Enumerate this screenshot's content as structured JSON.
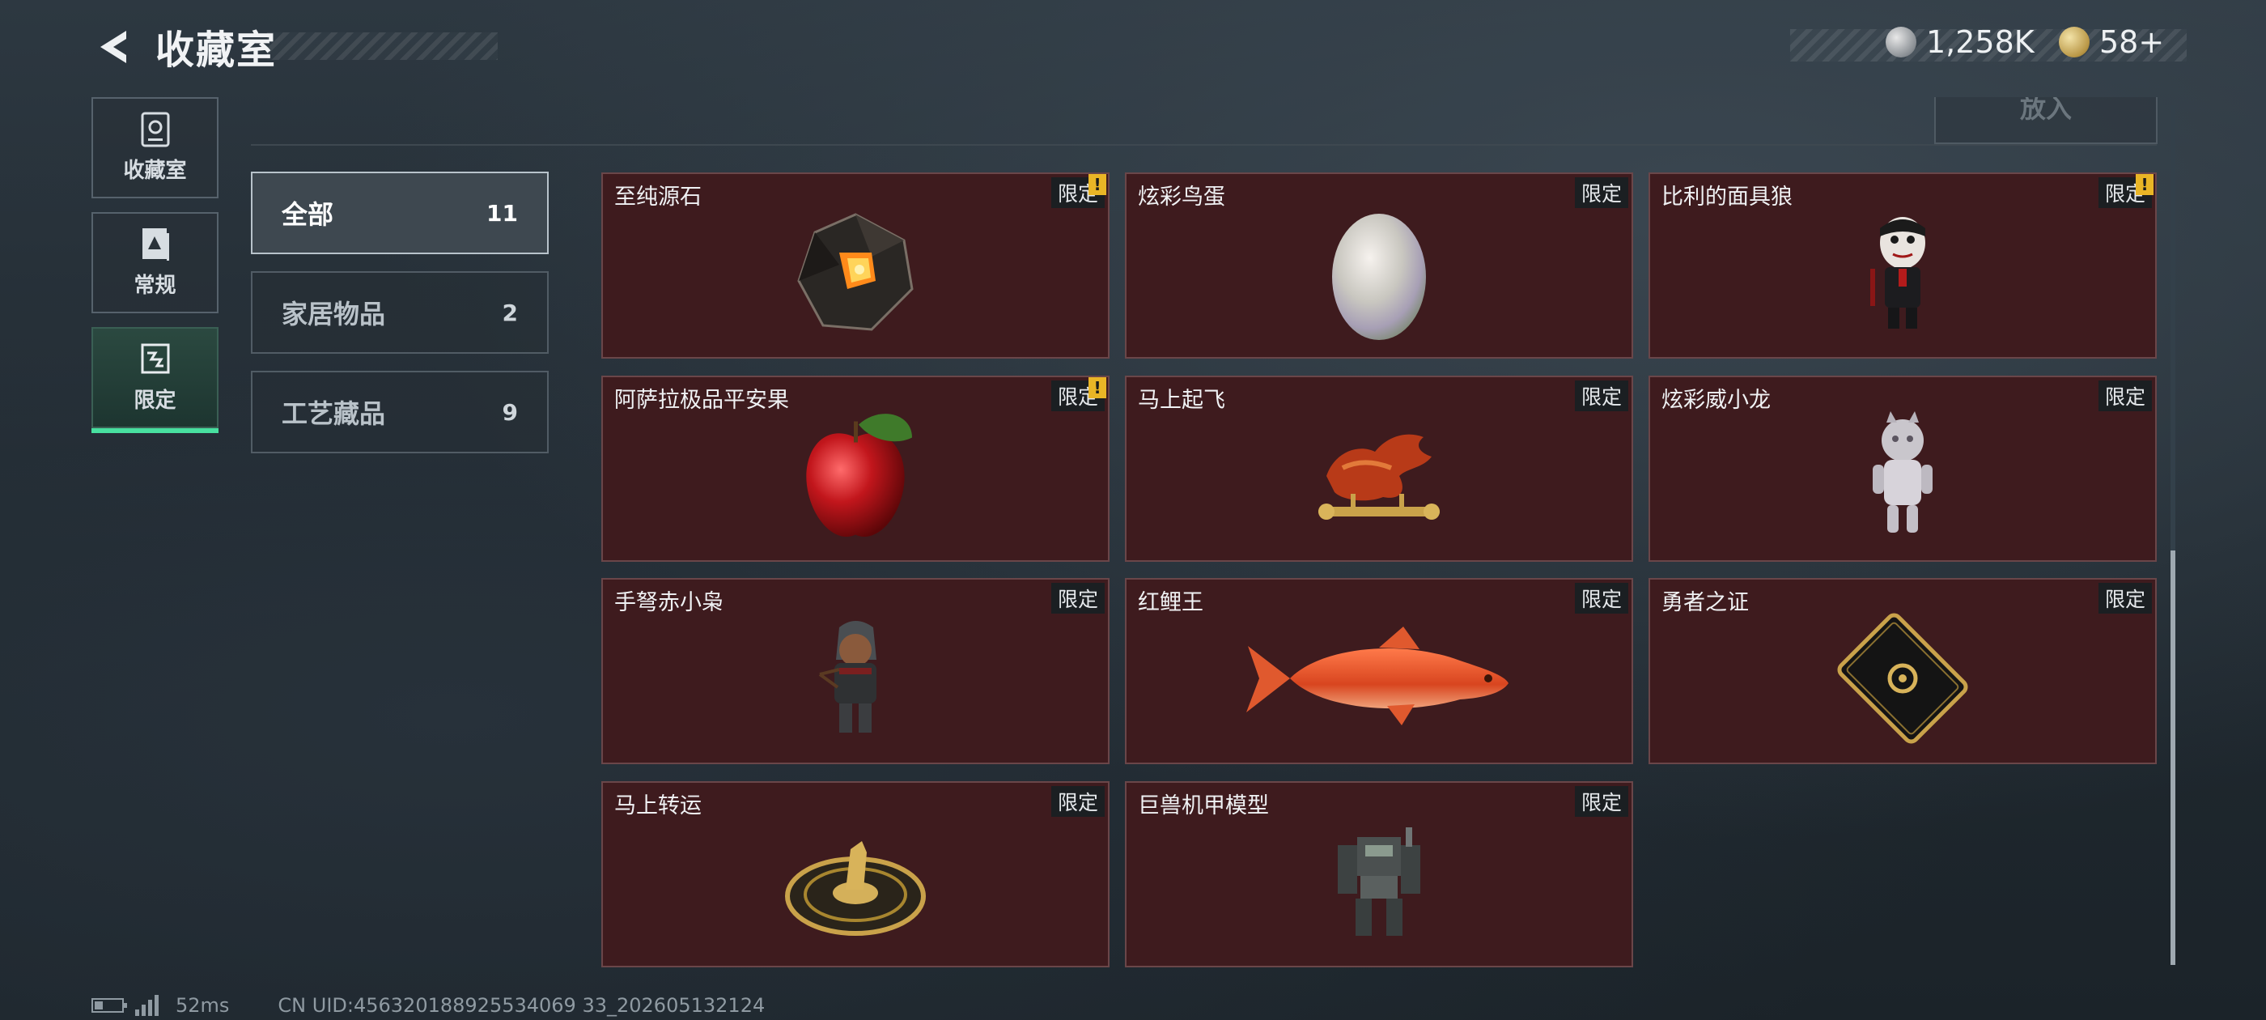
{
  "header": {
    "title": "收藏室",
    "currency": [
      {
        "icon": "silver-coin-icon",
        "value": "1,258K"
      },
      {
        "icon": "gold-coin-icon",
        "value": "58+"
      }
    ]
  },
  "nav": {
    "items": [
      {
        "label": "收藏室",
        "icon": "collection-icon",
        "active": false
      },
      {
        "label": "常规",
        "icon": "document-icon",
        "active": false
      },
      {
        "label": "限定",
        "icon": "limited-icon",
        "active": true
      }
    ]
  },
  "toolbar": {
    "put_label": "放入"
  },
  "categories": [
    {
      "label": "全部",
      "count": "11",
      "active": true
    },
    {
      "label": "家居物品",
      "count": "2",
      "active": false
    },
    {
      "label": "工艺藏品",
      "count": "9",
      "active": false
    }
  ],
  "items": [
    {
      "name": "至纯源石",
      "tag": "限定",
      "alert": true,
      "icon": "stone-icon"
    },
    {
      "name": "炫彩鸟蛋",
      "tag": "限定",
      "alert": false,
      "icon": "egg-icon"
    },
    {
      "name": "比利的面具狼",
      "tag": "限定",
      "alert": true,
      "icon": "puppet-icon"
    },
    {
      "name": "阿萨拉极品平安果",
      "tag": "限定",
      "alert": true,
      "icon": "apple-icon"
    },
    {
      "name": "马上起飞",
      "tag": "限定",
      "alert": false,
      "icon": "horse-icon"
    },
    {
      "name": "炫彩威小龙",
      "tag": "限定",
      "alert": false,
      "icon": "dragon-figure-icon"
    },
    {
      "name": "手弩赤小枭",
      "tag": "限定",
      "alert": false,
      "icon": "archer-figure-icon"
    },
    {
      "name": "红鲤王",
      "tag": "限定",
      "alert": false,
      "icon": "carp-icon"
    },
    {
      "name": "勇者之证",
      "tag": "限定",
      "alert": false,
      "icon": "card-icon"
    },
    {
      "name": "马上转运",
      "tag": "限定",
      "alert": false,
      "icon": "horse-disc-icon"
    },
    {
      "name": "巨兽机甲模型",
      "tag": "限定",
      "alert": false,
      "icon": "mech-icon"
    }
  ],
  "alert_symbol": "!",
  "footer": {
    "ping": "52ms",
    "uid": "CN UID:456320188925534069 33_202605132124"
  }
}
